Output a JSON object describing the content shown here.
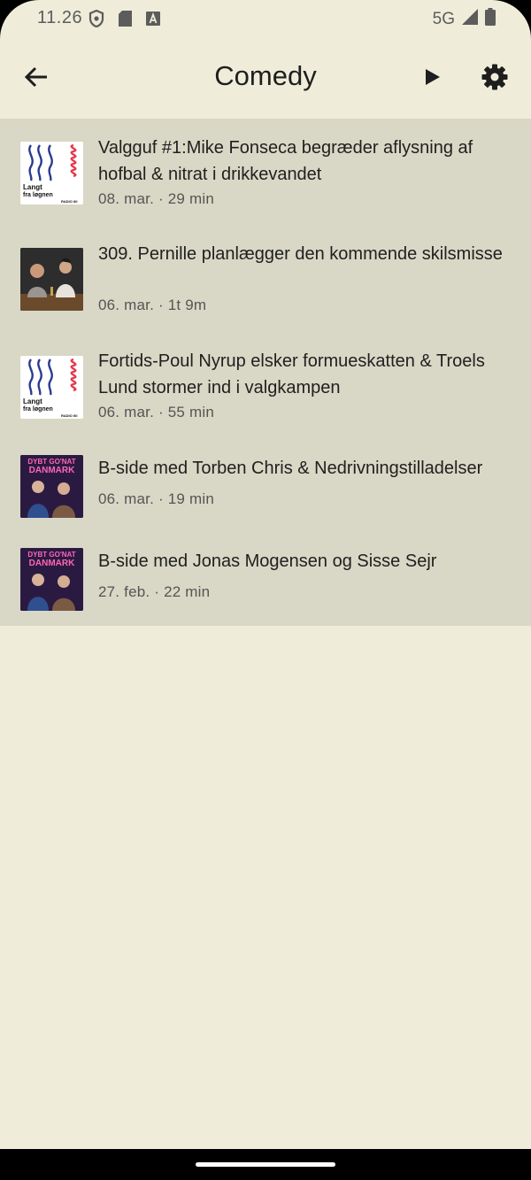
{
  "status_bar": {
    "time": "11.26",
    "network": "5G",
    "left_icons": [
      "shield-icon",
      "sd-card-icon",
      "font-a-icon"
    ],
    "right_icons": [
      "signal-icon",
      "battery-icon"
    ]
  },
  "appbar": {
    "title": "Comedy",
    "back_icon": "arrow-left-icon",
    "play_icon": "play-icon",
    "settings_icon": "gear-icon"
  },
  "episodes": [
    {
      "title": "Valgguf #1:Mike Fonseca begræder aflysning af hofbal & nitrat i drikkevandet",
      "date": "08. mar.",
      "duration": "29 min",
      "podcast_art": "Langt fra løgnen",
      "art_lines": [
        "Langt",
        "fra løgnen",
        "RADIO IIII"
      ]
    },
    {
      "title": "309. Pernille planlægger den kommende skilsmisse",
      "date": "06. mar.",
      "duration": "1t 9m",
      "podcast_art": "photo"
    },
    {
      "title": "Fortids-Poul Nyrup elsker formueskatten & Troels Lund stormer ind i valgkampen",
      "date": "06. mar.",
      "duration": "55 min",
      "podcast_art": "Langt fra løgnen",
      "art_lines": [
        "Langt",
        "fra løgnen",
        "RADIO IIII"
      ]
    },
    {
      "title": "B-side med Torben Chris & Nedrivningstilladelser",
      "date": "06. mar.",
      "duration": "19 min",
      "podcast_art": "Dybt Go'nat Danmark",
      "art_lines": [
        "DYBT GO'NAT",
        "DANMARK"
      ]
    },
    {
      "title": "B-side med Jonas Mogensen og Sisse Sejr",
      "date": "27. feb.",
      "duration": "22 min",
      "podcast_art": "Dybt Go'nat Danmark",
      "art_lines": [
        "DYBT GO'NAT",
        "DANMARK"
      ]
    }
  ],
  "meta_separator": "·",
  "colors": {
    "background": "#efedda",
    "list_background": "#d9d8c6",
    "title_text": "#202020",
    "meta_text": "#555555"
  }
}
